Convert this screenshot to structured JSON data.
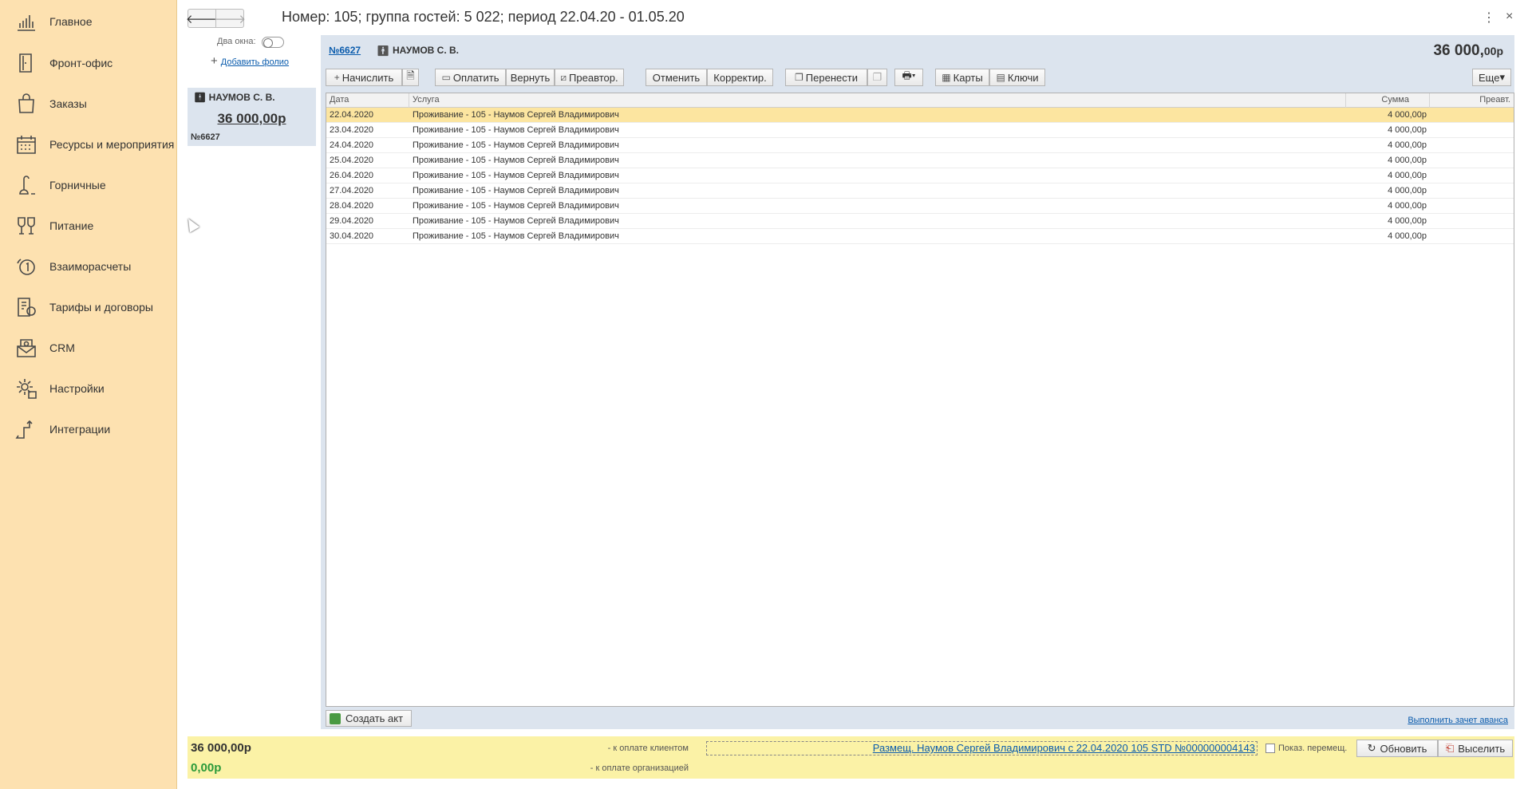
{
  "sidebar": {
    "items": [
      {
        "label": "Главное",
        "icon": "bar-chart-icon"
      },
      {
        "label": "Фронт-офис",
        "icon": "door-icon"
      },
      {
        "label": "Заказы",
        "icon": "shopping-bag-icon"
      },
      {
        "label": "Ресурсы и мероприятия",
        "icon": "calendar-icon"
      },
      {
        "label": "Горничные",
        "icon": "vacuum-icon"
      },
      {
        "label": "Питание",
        "icon": "glasses-icon"
      },
      {
        "label": "Взаиморасчеты",
        "icon": "settlement-icon"
      },
      {
        "label": "Тарифы и договоры",
        "icon": "contract-icon"
      },
      {
        "label": "CRM",
        "icon": "mail-icon"
      },
      {
        "label": "Настройки",
        "icon": "gear-icon"
      },
      {
        "label": "Интеграции",
        "icon": "integration-icon"
      }
    ]
  },
  "window": {
    "title": "Номер: 105; группа гостей: 5 022; период 22.04.20 - 01.05.20",
    "back_glyph": "🡐",
    "forward_glyph": "🡒",
    "menu_glyph": "⋮",
    "close_glyph": "×"
  },
  "folio_panel": {
    "two_windows_label": "Два окна:",
    "add_folio_plus": "+",
    "add_folio_label": "Добавить фолио",
    "card": {
      "guest": "НАУМОВ С. В.",
      "amount": "36 000,00р",
      "number": "№6627"
    }
  },
  "folio": {
    "number_link": "№6627",
    "guest": "НАУМОВ С. В.",
    "total_main": "36 000,",
    "total_minor": "00р"
  },
  "toolbar": {
    "charge_label": "Начислить",
    "charge_glyph": "+",
    "pay_label": "Оплатить",
    "refund_label": "Вернуть",
    "prepay_label": "Преавтор.",
    "cancel_label": "Отменить",
    "correct_label": "Корректир.",
    "transfer_label": "Перенести",
    "cards_label": "Карты",
    "keys_label": "Ключи",
    "more_label": "Еще"
  },
  "table": {
    "columns": [
      "Дата",
      "Услуга",
      "Сумма",
      "Преавт."
    ],
    "rows": [
      {
        "date": "22.04.2020",
        "service": "Проживание - 105 - Наумов Сергей Владимирович",
        "sum": "4 000,00р"
      },
      {
        "date": "23.04.2020",
        "service": "Проживание - 105 - Наумов Сергей Владимирович",
        "sum": "4 000,00р"
      },
      {
        "date": "24.04.2020",
        "service": "Проживание - 105 - Наумов Сергей Владимирович",
        "sum": "4 000,00р"
      },
      {
        "date": "25.04.2020",
        "service": "Проживание - 105 - Наумов Сергей Владимирович",
        "sum": "4 000,00р"
      },
      {
        "date": "26.04.2020",
        "service": "Проживание - 105 - Наумов Сергей Владимирович",
        "sum": "4 000,00р"
      },
      {
        "date": "27.04.2020",
        "service": "Проживание - 105 - Наумов Сергей Владимирович",
        "sum": "4 000,00р"
      },
      {
        "date": "28.04.2020",
        "service": "Проживание - 105 - Наумов Сергей Владимирович",
        "sum": "4 000,00р"
      },
      {
        "date": "29.04.2020",
        "service": "Проживание - 105 - Наумов Сергей Владимирович",
        "sum": "4 000,00р"
      },
      {
        "date": "30.04.2020",
        "service": "Проживание - 105 - Наумов Сергей Владимирович",
        "sum": "4 000,00р"
      }
    ]
  },
  "actions": {
    "create_act_label": "Создать акт",
    "advance_offset_label": "Выполнить зачет аванса"
  },
  "bottom": {
    "client_due_amount": "36 000,00р",
    "client_due_label": "- к оплате клиентом",
    "org_due_amount": "0,00р",
    "org_due_label": "- к оплате организацией",
    "placement_link": "Размещ. Наумов Сергей Владимирович с 22.04.2020 105 STD №000000004143",
    "show_moves_label": "Показ. перемещ.",
    "refresh_label": "Обновить",
    "checkout_label": "Выселить"
  },
  "colors": {
    "sidebar_bg": "#fde1b0",
    "panel_bg": "#dce4ee",
    "selected_row": "#fce5a0",
    "status_bar": "#fbf2a6",
    "link": "#0b5cad",
    "positive": "#2a9a3a"
  }
}
